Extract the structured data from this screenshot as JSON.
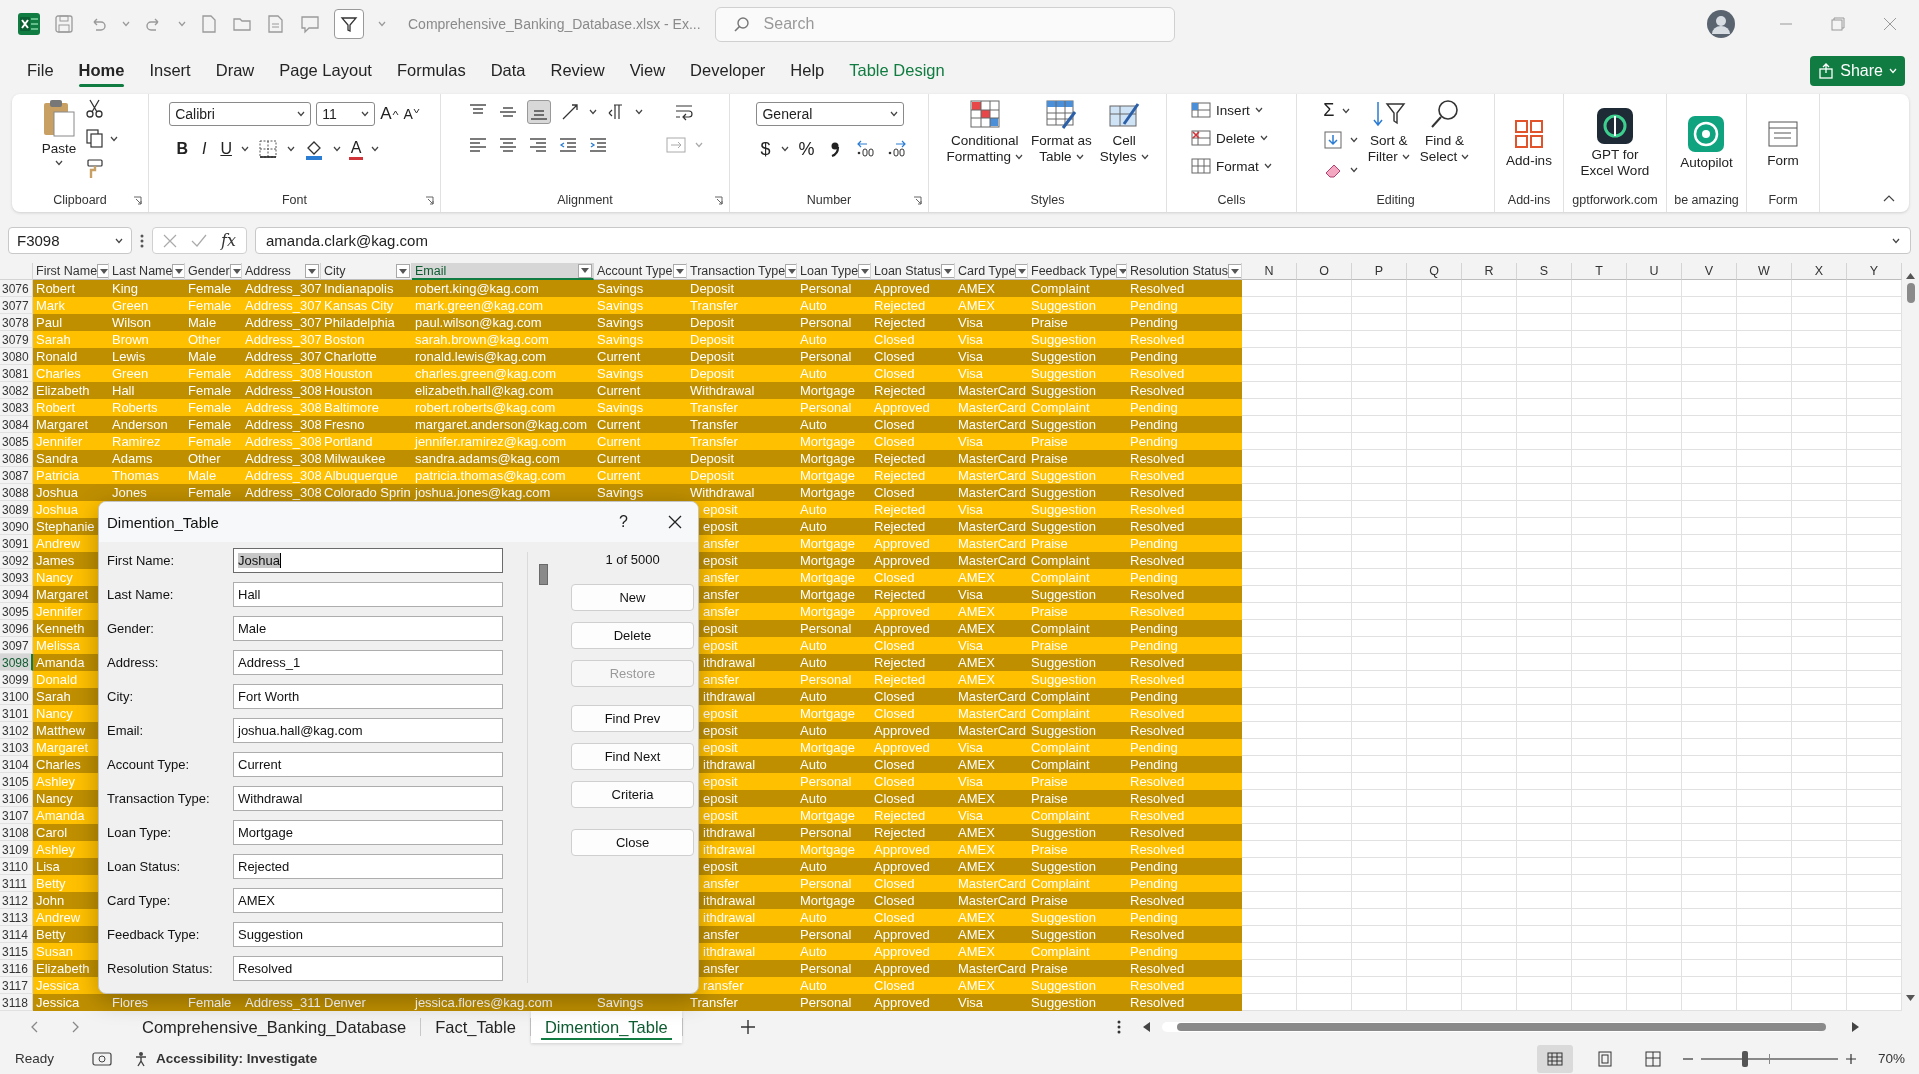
{
  "window": {
    "title": "Comprehensive_Banking_Database.xlsx - Ex...",
    "search": {
      "placeholder": "Search"
    }
  },
  "ribbon_tabs": [
    {
      "label": "File",
      "selected": false,
      "kind": "plain"
    },
    {
      "label": "Home",
      "selected": true,
      "kind": "plain"
    },
    {
      "label": "Insert",
      "selected": false,
      "kind": "plain"
    },
    {
      "label": "Draw",
      "selected": false,
      "kind": "plain"
    },
    {
      "label": "Page Layout",
      "selected": false,
      "kind": "plain"
    },
    {
      "label": "Formulas",
      "selected": false,
      "kind": "plain"
    },
    {
      "label": "Data",
      "selected": false,
      "kind": "plain"
    },
    {
      "label": "Review",
      "selected": false,
      "kind": "plain"
    },
    {
      "label": "View",
      "selected": false,
      "kind": "plain"
    },
    {
      "label": "Developer",
      "selected": false,
      "kind": "plain"
    },
    {
      "label": "Help",
      "selected": false,
      "kind": "plain"
    },
    {
      "label": "Table Design",
      "selected": false,
      "kind": "contextual"
    }
  ],
  "share": "Share",
  "ribbon": {
    "groups": [
      {
        "kind": "clipboard",
        "label": "Clipboard",
        "launcher": true,
        "paste": "Paste"
      },
      {
        "kind": "font",
        "label": "Font",
        "launcher": true,
        "font": "Calibri",
        "size": "11",
        "grow": "A",
        "shrink": "A",
        "styles": [
          "B",
          "I",
          "U"
        ],
        "font_color": "A"
      },
      {
        "kind": "alignment",
        "label": "Alignment",
        "launcher": true
      },
      {
        "kind": "number",
        "label": "Number",
        "launcher": true,
        "format": "General",
        "currency": "$",
        "percent": "%"
      },
      {
        "kind": "styles",
        "label": "Styles",
        "launcher": false,
        "buttons": [
          {
            "label": "Conditional\nFormatting",
            "menu": true
          },
          {
            "label": "Format as\nTable",
            "menu": true
          },
          {
            "label": "Cell\nStyles",
            "menu": true
          }
        ]
      },
      {
        "kind": "cells",
        "label": "Cells",
        "launcher": false,
        "buttons": [
          {
            "label": "Insert",
            "menu": true
          },
          {
            "label": "Delete",
            "menu": true
          },
          {
            "label": "Format",
            "menu": true
          }
        ]
      },
      {
        "kind": "editing",
        "label": "Editing",
        "launcher": false,
        "sum": "Σ",
        "buttons": [
          {
            "label": "Sort &\nFilter",
            "menu": true
          },
          {
            "label": "Find &\nSelect",
            "menu": true
          }
        ]
      },
      {
        "kind": "addins",
        "label": "Add-ins",
        "launcher": false,
        "buttons": [
          {
            "label": "Add-ins",
            "menu": false
          }
        ]
      },
      {
        "kind": "gpt",
        "label": "gptforwork.com",
        "launcher": false,
        "buttons": [
          {
            "label": "GPT for\nExcel Word",
            "menu": false
          }
        ]
      },
      {
        "kind": "autopilot",
        "label": "be amazing",
        "launcher": false,
        "buttons": [
          {
            "label": "Autopilot",
            "menu": false
          }
        ]
      },
      {
        "kind": "form",
        "label": "Form",
        "launcher": false,
        "buttons": [
          {
            "label": "Form",
            "menu": false
          }
        ]
      }
    ]
  },
  "formula_bar": {
    "name_box": "F3098",
    "function_label": "fx",
    "formula": "amanda.clark@kag.com"
  },
  "sheet": {
    "table_columns": [
      {
        "label": "First Name",
        "selected": false
      },
      {
        "label": "Last Name",
        "selected": false
      },
      {
        "label": "Gender",
        "selected": false
      },
      {
        "label": "Address",
        "selected": false
      },
      {
        "label": "City",
        "selected": false
      },
      {
        "label": "Email",
        "selected": true
      },
      {
        "label": "Account Type",
        "selected": false
      },
      {
        "label": "Transaction Type",
        "selected": false
      },
      {
        "label": "Loan Type",
        "selected": false
      },
      {
        "label": "Loan Status",
        "selected": false
      },
      {
        "label": "Card Type",
        "selected": false
      },
      {
        "label": "Feedback Type",
        "selected": false
      },
      {
        "label": "Resolution Status",
        "selected": false
      }
    ],
    "column_letters": [
      "N",
      "O",
      "P",
      "Q",
      "R",
      "S",
      "T",
      "U",
      "V",
      "W",
      "X",
      "Y"
    ],
    "rows": [
      {
        "number": "3076",
        "selected": false,
        "cells": [
          "Robert",
          "King",
          "Female",
          "Address_307",
          "Indianapolis",
          "robert.king@kag.com",
          "Savings",
          "Deposit",
          "Personal",
          "Approved",
          "AMEX",
          "Complaint",
          "Resolved"
        ]
      },
      {
        "number": "3077",
        "selected": false,
        "cells": [
          "Mark",
          "Green",
          "Female",
          "Address_307",
          "Kansas City",
          "mark.green@kag.com",
          "Savings",
          "Transfer",
          "Auto",
          "Rejected",
          "AMEX",
          "Suggestion",
          "Pending"
        ]
      },
      {
        "number": "3078",
        "selected": false,
        "cells": [
          "Paul",
          "Wilson",
          "Male",
          "Address_307",
          "Philadelphia",
          "paul.wilson@kag.com",
          "Savings",
          "Deposit",
          "Personal",
          "Rejected",
          "Visa",
          "Praise",
          "Pending"
        ]
      },
      {
        "number": "3079",
        "selected": false,
        "cells": [
          "Sarah",
          "Brown",
          "Other",
          "Address_307",
          "Boston",
          "sarah.brown@kag.com",
          "Savings",
          "Deposit",
          "Auto",
          "Closed",
          "Visa",
          "Suggestion",
          "Resolved"
        ]
      },
      {
        "number": "3080",
        "selected": false,
        "cells": [
          "Ronald",
          "Lewis",
          "Male",
          "Address_307",
          "Charlotte",
          "ronald.lewis@kag.com",
          "Current",
          "Deposit",
          "Personal",
          "Closed",
          "Visa",
          "Suggestion",
          "Pending"
        ]
      },
      {
        "number": "3081",
        "selected": false,
        "cells": [
          "Charles",
          "Green",
          "Female",
          "Address_308",
          "Houston",
          "charles.green@kag.com",
          "Savings",
          "Deposit",
          "Auto",
          "Closed",
          "Visa",
          "Suggestion",
          "Resolved"
        ]
      },
      {
        "number": "3082",
        "selected": false,
        "cells": [
          "Elizabeth",
          "Hall",
          "Female",
          "Address_308",
          "Houston",
          "elizabeth.hall@kag.com",
          "Current",
          "Withdrawal",
          "Mortgage",
          "Rejected",
          "MasterCard",
          "Suggestion",
          "Resolved"
        ]
      },
      {
        "number": "3083",
        "selected": false,
        "cells": [
          "Robert",
          "Roberts",
          "Female",
          "Address_308",
          "Baltimore",
          "robert.roberts@kag.com",
          "Savings",
          "Transfer",
          "Personal",
          "Approved",
          "MasterCard",
          "Complaint",
          "Pending"
        ]
      },
      {
        "number": "3084",
        "selected": false,
        "cells": [
          "Margaret",
          "Anderson",
          "Female",
          "Address_308",
          "Fresno",
          "margaret.anderson@kag.com",
          "Current",
          "Transfer",
          "Auto",
          "Closed",
          "MasterCard",
          "Suggestion",
          "Pending"
        ]
      },
      {
        "number": "3085",
        "selected": false,
        "cells": [
          "Jennifer",
          "Ramirez",
          "Female",
          "Address_308",
          "Portland",
          "jennifer.ramirez@kag.com",
          "Current",
          "Transfer",
          "Mortgage",
          "Closed",
          "Visa",
          "Praise",
          "Pending"
        ]
      },
      {
        "number": "3086",
        "selected": false,
        "cells": [
          "Sandra",
          "Adams",
          "Other",
          "Address_308",
          "Milwaukee",
          "sandra.adams@kag.com",
          "Current",
          "Deposit",
          "Mortgage",
          "Rejected",
          "MasterCard",
          "Praise",
          "Resolved"
        ]
      },
      {
        "number": "3087",
        "selected": false,
        "cells": [
          "Patricia",
          "Thomas",
          "Male",
          "Address_308",
          "Albuquerque",
          "patricia.thomas@kag.com",
          "Current",
          "Deposit",
          "Mortgage",
          "Rejected",
          "MasterCard",
          "Suggestion",
          "Resolved"
        ]
      },
      {
        "number": "3088",
        "selected": false,
        "cells": [
          "Joshua",
          "Jones",
          "Female",
          "Address_308",
          "Colorado Sprin",
          "joshua.jones@kag.com",
          "Savings",
          "Withdrawal",
          "Mortgage",
          "Closed",
          "MasterCard",
          "Suggestion",
          "Resolved"
        ]
      },
      {
        "number": "3089",
        "selected": false,
        "cells": [
          "Joshua",
          null,
          null,
          null,
          null,
          null,
          null,
          "eposit",
          "Auto",
          "Rejected",
          "Visa",
          "Suggestion",
          "Resolved"
        ]
      },
      {
        "number": "3090",
        "selected": false,
        "cells": [
          "Stephanie",
          null,
          null,
          null,
          null,
          null,
          null,
          "eposit",
          "Auto",
          "Rejected",
          "MasterCard",
          "Suggestion",
          "Resolved"
        ]
      },
      {
        "number": "3091",
        "selected": false,
        "cells": [
          "Andrew",
          null,
          null,
          null,
          null,
          null,
          null,
          "ansfer",
          "Mortgage",
          "Approved",
          "MasterCard",
          "Praise",
          "Pending"
        ]
      },
      {
        "number": "3092",
        "selected": false,
        "cells": [
          "James",
          null,
          null,
          null,
          null,
          null,
          null,
          "eposit",
          "Mortgage",
          "Approved",
          "MasterCard",
          "Complaint",
          "Resolved"
        ]
      },
      {
        "number": "3093",
        "selected": false,
        "cells": [
          "Nancy",
          null,
          null,
          null,
          null,
          null,
          null,
          "ansfer",
          "Mortgage",
          "Closed",
          "AMEX",
          "Complaint",
          "Pending"
        ]
      },
      {
        "number": "3094",
        "selected": false,
        "cells": [
          "Margaret",
          null,
          null,
          null,
          null,
          null,
          null,
          "ansfer",
          "Mortgage",
          "Rejected",
          "Visa",
          "Suggestion",
          "Resolved"
        ]
      },
      {
        "number": "3095",
        "selected": false,
        "cells": [
          "Jennifer",
          null,
          null,
          null,
          null,
          null,
          null,
          "ansfer",
          "Mortgage",
          "Approved",
          "AMEX",
          "Praise",
          "Resolved"
        ]
      },
      {
        "number": "3096",
        "selected": false,
        "cells": [
          "Kenneth",
          null,
          null,
          null,
          null,
          null,
          null,
          "eposit",
          "Personal",
          "Approved",
          "AMEX",
          "Complaint",
          "Pending"
        ]
      },
      {
        "number": "3097",
        "selected": false,
        "cells": [
          "Melissa",
          null,
          null,
          null,
          null,
          null,
          null,
          "eposit",
          "Auto",
          "Closed",
          "Visa",
          "Praise",
          "Pending"
        ]
      },
      {
        "number": "3098",
        "selected": true,
        "cells": [
          "Amanda",
          null,
          null,
          null,
          null,
          null,
          null,
          "ithdrawal",
          "Auto",
          "Rejected",
          "AMEX",
          "Suggestion",
          "Resolved"
        ]
      },
      {
        "number": "3099",
        "selected": false,
        "cells": [
          "Donald",
          null,
          null,
          null,
          null,
          null,
          null,
          "ansfer",
          "Personal",
          "Rejected",
          "AMEX",
          "Suggestion",
          "Resolved"
        ]
      },
      {
        "number": "3100",
        "selected": false,
        "cells": [
          "Sarah",
          null,
          null,
          null,
          null,
          null,
          null,
          "ithdrawal",
          "Auto",
          "Closed",
          "MasterCard",
          "Complaint",
          "Pending"
        ]
      },
      {
        "number": "3101",
        "selected": false,
        "cells": [
          "Nancy",
          null,
          null,
          null,
          null,
          null,
          null,
          "eposit",
          "Mortgage",
          "Closed",
          "MasterCard",
          "Complaint",
          "Resolved"
        ]
      },
      {
        "number": "3102",
        "selected": false,
        "cells": [
          "Matthew",
          null,
          null,
          null,
          null,
          null,
          null,
          "eposit",
          "Auto",
          "Approved",
          "MasterCard",
          "Suggestion",
          "Resolved"
        ]
      },
      {
        "number": "3103",
        "selected": false,
        "cells": [
          "Margaret",
          null,
          null,
          null,
          null,
          null,
          null,
          "eposit",
          "Mortgage",
          "Approved",
          "Visa",
          "Complaint",
          "Pending"
        ]
      },
      {
        "number": "3104",
        "selected": false,
        "cells": [
          "Charles",
          null,
          null,
          null,
          null,
          null,
          null,
          "ithdrawal",
          "Auto",
          "Closed",
          "AMEX",
          "Complaint",
          "Pending"
        ]
      },
      {
        "number": "3105",
        "selected": false,
        "cells": [
          "Ashley",
          null,
          null,
          null,
          null,
          null,
          null,
          "eposit",
          "Personal",
          "Closed",
          "Visa",
          "Praise",
          "Resolved"
        ]
      },
      {
        "number": "3106",
        "selected": false,
        "cells": [
          "Nancy",
          null,
          null,
          null,
          null,
          null,
          null,
          "eposit",
          "Auto",
          "Closed",
          "AMEX",
          "Praise",
          "Resolved"
        ]
      },
      {
        "number": "3107",
        "selected": false,
        "cells": [
          "Amanda",
          null,
          null,
          null,
          null,
          null,
          null,
          "eposit",
          "Mortgage",
          "Rejected",
          "Visa",
          "Complaint",
          "Resolved"
        ]
      },
      {
        "number": "3108",
        "selected": false,
        "cells": [
          "Carol",
          null,
          null,
          null,
          null,
          null,
          null,
          "ithdrawal",
          "Personal",
          "Rejected",
          "AMEX",
          "Suggestion",
          "Resolved"
        ]
      },
      {
        "number": "3109",
        "selected": false,
        "cells": [
          "Ashley",
          null,
          null,
          null,
          null,
          null,
          null,
          "ithdrawal",
          "Mortgage",
          "Approved",
          "AMEX",
          "Praise",
          "Resolved"
        ]
      },
      {
        "number": "3110",
        "selected": false,
        "cells": [
          "Lisa",
          null,
          null,
          null,
          null,
          null,
          null,
          "eposit",
          "Auto",
          "Approved",
          "AMEX",
          "Suggestion",
          "Pending"
        ]
      },
      {
        "number": "3111",
        "selected": false,
        "cells": [
          "Betty",
          null,
          null,
          null,
          null,
          null,
          null,
          "ansfer",
          "Personal",
          "Closed",
          "MasterCard",
          "Complaint",
          "Pending"
        ]
      },
      {
        "number": "3112",
        "selected": false,
        "cells": [
          "John",
          null,
          null,
          null,
          null,
          null,
          null,
          "ithdrawal",
          "Mortgage",
          "Closed",
          "MasterCard",
          "Praise",
          "Resolved"
        ]
      },
      {
        "number": "3113",
        "selected": false,
        "cells": [
          "Andrew",
          null,
          null,
          null,
          null,
          null,
          null,
          "ithdrawal",
          "Auto",
          "Closed",
          "AMEX",
          "Suggestion",
          "Pending"
        ]
      },
      {
        "number": "3114",
        "selected": false,
        "cells": [
          "Betty",
          null,
          null,
          null,
          null,
          null,
          null,
          "ansfer",
          "Personal",
          "Approved",
          "AMEX",
          "Suggestion",
          "Resolved"
        ]
      },
      {
        "number": "3115",
        "selected": false,
        "cells": [
          "Susan",
          null,
          null,
          null,
          null,
          null,
          null,
          "ithdrawal",
          "Auto",
          "Approved",
          "AMEX",
          "Complaint",
          "Pending"
        ]
      },
      {
        "number": "3116",
        "selected": false,
        "cells": [
          "Elizabeth",
          null,
          null,
          null,
          null,
          null,
          null,
          "ansfer",
          "Personal",
          "Approved",
          "MasterCard",
          "Praise",
          "Resolved"
        ]
      },
      {
        "number": "3117",
        "selected": false,
        "cells": [
          "Jessica",
          null,
          null,
          null,
          null,
          null,
          null,
          "ransfer",
          "Auto",
          "Closed",
          "AMEX",
          "Suggestion",
          "Resolved"
        ]
      },
      {
        "number": "3118",
        "selected": false,
        "cells": [
          "Jessica",
          "Flores",
          "Female",
          "Address_311",
          "Denver",
          "jessica.flores@kag.com",
          "Savings",
          "Transfer",
          "Personal",
          "Approved",
          "Visa",
          "Suggestion",
          "Resolved"
        ]
      }
    ]
  },
  "dialog": {
    "title": "Dimention_Table",
    "help": "?",
    "counter": "1 of 5000",
    "fields": [
      {
        "label": "First Name:",
        "value": "Joshua",
        "selected": true
      },
      {
        "label": "Last Name:",
        "value": "Hall",
        "selected": false
      },
      {
        "label": "Gender:",
        "value": "Male",
        "selected": false
      },
      {
        "label": "Address:",
        "value": "Address_1",
        "selected": false
      },
      {
        "label": "City:",
        "value": "Fort Worth",
        "selected": false
      },
      {
        "label": "Email:",
        "value": "joshua.hall@kag.com",
        "selected": false
      },
      {
        "label": "Account Type:",
        "value": "Current",
        "selected": false
      },
      {
        "label": "Transaction Type:",
        "value": "Withdrawal",
        "selected": false
      },
      {
        "label": "Loan Type:",
        "value": "Mortgage",
        "selected": false
      },
      {
        "label": "Loan Status:",
        "value": "Rejected",
        "selected": false
      },
      {
        "label": "Card Type:",
        "value": "AMEX",
        "selected": false
      },
      {
        "label": "Feedback Type:",
        "value": "Suggestion",
        "selected": false
      },
      {
        "label": "Resolution Status:",
        "value": "Resolved",
        "selected": false
      }
    ],
    "button_groups": [
      [
        {
          "label": "New",
          "disabled": false
        },
        {
          "label": "Delete",
          "disabled": false
        },
        {
          "label": "Restore",
          "disabled": true
        }
      ],
      [
        {
          "label": "Find Prev",
          "disabled": false
        },
        {
          "label": "Find Next",
          "disabled": false
        },
        {
          "label": "Criteria",
          "disabled": false
        }
      ],
      [
        {
          "label": "Close",
          "disabled": false
        }
      ]
    ]
  },
  "sheet_tabs": [
    {
      "label": "Comprehensive_Banking_Database",
      "selected": false
    },
    {
      "label": "Fact_Table",
      "selected": false
    },
    {
      "label": "Dimention_Table",
      "selected": true
    }
  ],
  "status_bar": {
    "mode": "Ready",
    "accessibility": "Accessibility: Investigate",
    "zoom": {
      "level": 0.32,
      "label": "70%"
    }
  }
}
